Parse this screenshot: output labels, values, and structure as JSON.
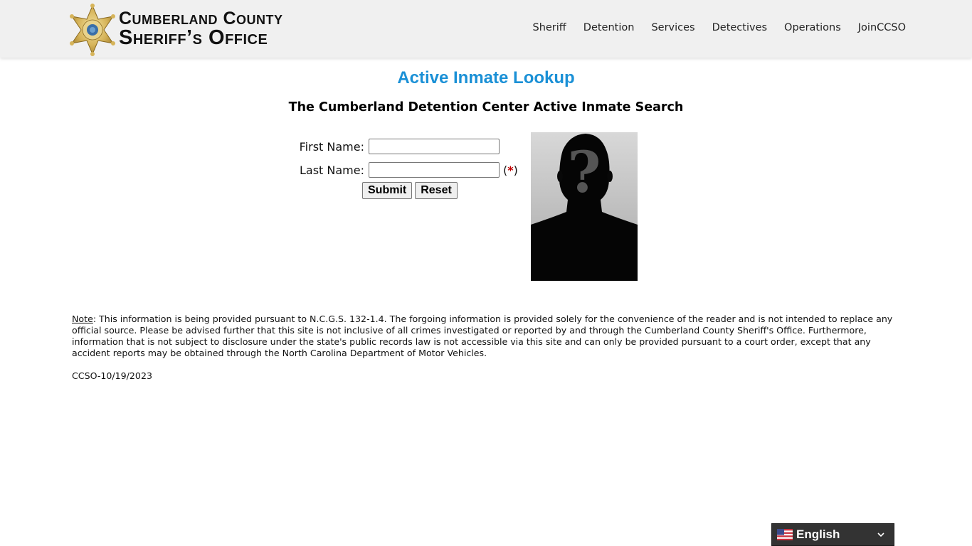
{
  "header": {
    "logo_line1": "Cumberland County",
    "logo_line2": "Sheriff’s Office",
    "nav": [
      {
        "label": "Sheriff"
      },
      {
        "label": "Detention"
      },
      {
        "label": "Services"
      },
      {
        "label": "Detectives"
      },
      {
        "label": "Operations"
      },
      {
        "label": "JoinCCSO"
      }
    ]
  },
  "main": {
    "title": "Active Inmate Lookup",
    "subtitle": "The Cumberland Detention Center Active Inmate Search",
    "form": {
      "first_name_label": "First Name:",
      "first_name_value": "",
      "last_name_label": "Last Name:",
      "last_name_value": "",
      "required_open": "(",
      "required_star": "*",
      "required_close": ")",
      "submit_label": "Submit",
      "reset_label": "Reset"
    },
    "photo_icon": "unknown-person-silhouette"
  },
  "footer": {
    "note_label": "Note",
    "note_text": ": This information is being provided pursuant to N.C.G.S. 132-1.4. The forgoing information is provided solely for the convenience of the reader and is not intended to replace any official source. Please be advised further that this site is not inclusive of all crimes investigated or reported by and through the Cumberland County Sheriff's Office. Furthermore, information that is not subject to disclosure under the state's public records law is not accessible via this site and can only be provided pursuant to a court order, except that any accident reports may be obtained through the North Carolina Department of Motor Vehicles.",
    "version": "CCSO-10/19/2023"
  },
  "language": {
    "selected": "English",
    "flag_icon": "us-flag-icon"
  },
  "colors": {
    "title": "#1a90d6",
    "required_star": "#c00000",
    "header_bg": "#f0f0f0",
    "lang_bg": "#333333"
  }
}
